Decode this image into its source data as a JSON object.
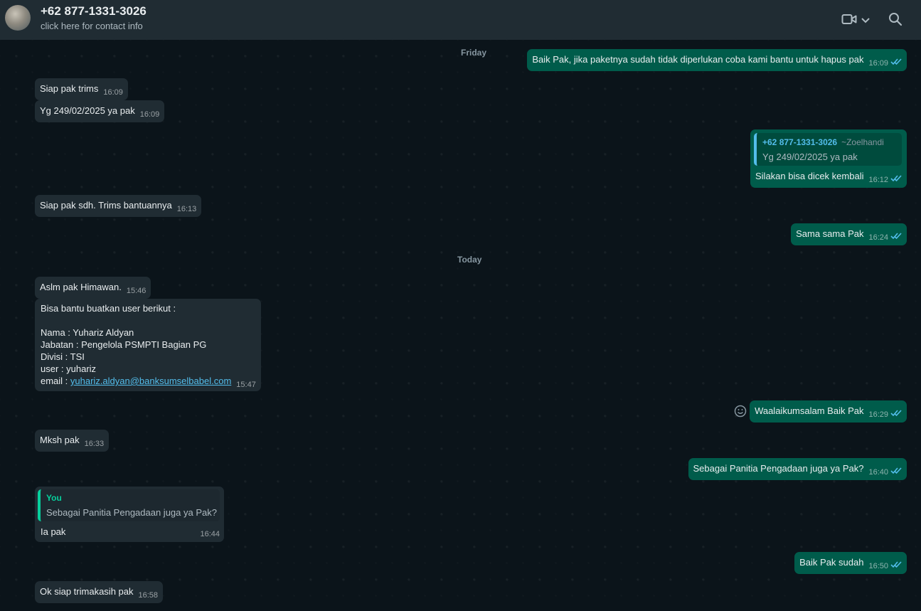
{
  "header": {
    "contact_name": "+62 877-1331-3026",
    "contact_sub": "click here for contact info",
    "icons": [
      "video-call-icon",
      "chevron-down-icon",
      "search-icon"
    ]
  },
  "dates": {
    "friday": "Friday",
    "today": "Today"
  },
  "messages": {
    "m1": {
      "text": "Baik Pak, jika paketnya sudah tidak diperlukan coba kami bantu untuk hapus pak",
      "time": "16:09"
    },
    "m2": {
      "text": "Siap pak trims",
      "time": "16:09"
    },
    "m3": {
      "text": "Yg 249/02/2025 ya pak",
      "time": "16:09"
    },
    "m4": {
      "quote_author": "+62 877-1331-3026",
      "quote_pushname": "~Zoelhandi",
      "quote_text": "Yg 249/02/2025 ya pak",
      "text": "Silakan bisa dicek kembali",
      "time": "16:12"
    },
    "m5": {
      "text": "Siap pak sdh. Trims bantuannya",
      "time": "16:13"
    },
    "m6": {
      "text": "Sama sama Pak",
      "time": "16:24"
    },
    "m7": {
      "text": "Aslm pak Himawan.",
      "time": "15:46"
    },
    "m8": {
      "line1": "Bisa bantu buatkan user berikut :",
      "line2": "Nama : Yuhariz Aldyan",
      "line3": "Jabatan : Pengelola PSMPTI Bagian PG",
      "line4": "Divisi : TSI",
      "line5": "user : yuhariz",
      "email_label": "email : ",
      "email": "yuhariz.aldyan@banksumselbabel.com",
      "time": "15:47"
    },
    "m9": {
      "text": "Waalaikumsalam Baik Pak",
      "time": "16:29"
    },
    "m10": {
      "text": "Mksh pak",
      "time": "16:33"
    },
    "m11": {
      "text": "Sebagai Panitia Pengadaan juga ya Pak?",
      "time": "16:40"
    },
    "m12": {
      "quote_author": "You",
      "quote_text": "Sebagai Panitia Pengadaan juga ya Pak?",
      "text": "Ia pak",
      "time": "16:44"
    },
    "m13": {
      "text": "Baik Pak sudah",
      "time": "16:50"
    },
    "m14": {
      "text": "Ok siap trimakasih pak",
      "time": "16:58"
    }
  },
  "colors": {
    "header_bg": "#202c33",
    "chat_bg": "#0b141a",
    "incoming_bubble": "#202c33",
    "outgoing_bubble": "#005c4b",
    "read_ticks": "#53bdeb",
    "quote_bar_other": "#53bdeb",
    "quote_bar_you": "#06cf9c"
  }
}
